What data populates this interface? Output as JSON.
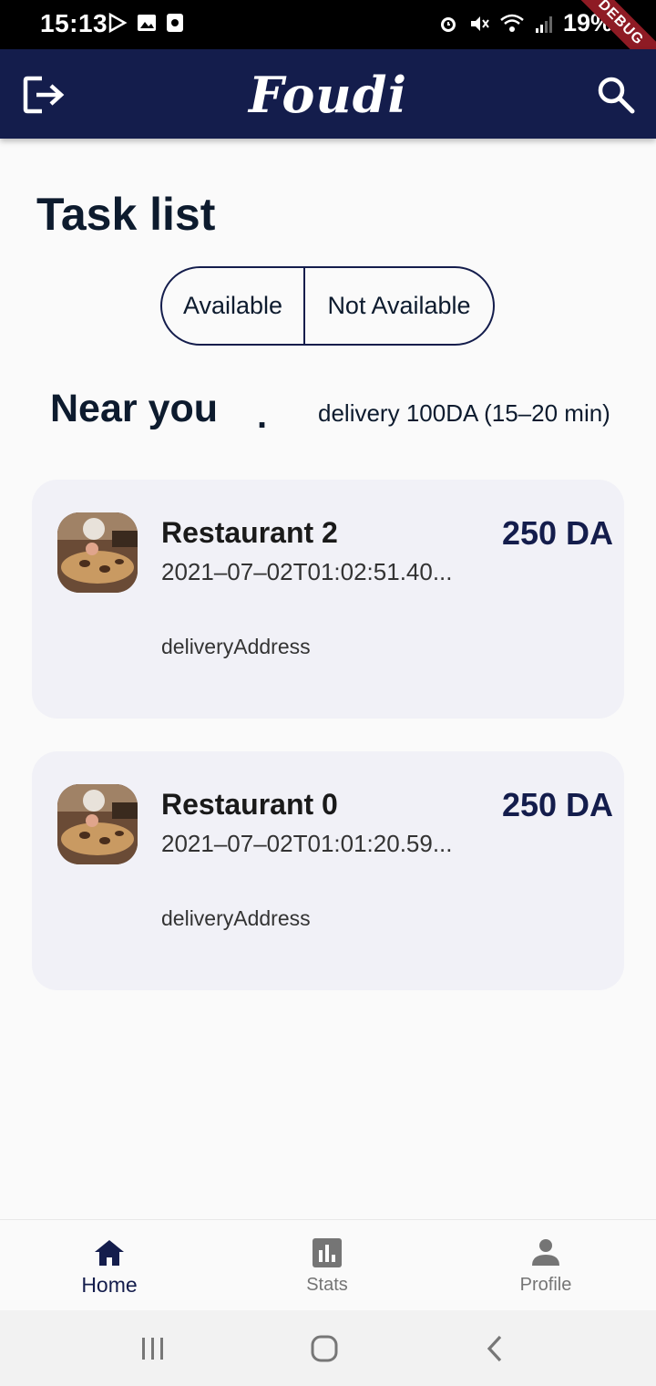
{
  "status_bar": {
    "time": "15:13",
    "battery": "19%",
    "debug_label": "DEBUG"
  },
  "app_bar": {
    "title": "Foudi"
  },
  "page": {
    "title": "Task list"
  },
  "availability": {
    "options": [
      "Available",
      "Not Available"
    ]
  },
  "near_you": {
    "heading": "Near you",
    "dot": ".",
    "delivery_info": "delivery 100DA (15–20 min)"
  },
  "tasks": [
    {
      "restaurant": "Restaurant 2",
      "date": "2021–07–02T01:02:51.40...",
      "price": "250 DA",
      "address": "deliveryAddress"
    },
    {
      "restaurant": "Restaurant 0",
      "date": "2021–07–02T01:01:20.59...",
      "price": "250 DA",
      "address": "deliveryAddress"
    }
  ],
  "bottom_nav": {
    "items": [
      {
        "label": "Home",
        "icon": "home-icon",
        "active": true
      },
      {
        "label": "Stats",
        "icon": "bar-chart-icon",
        "active": false
      },
      {
        "label": "Profile",
        "icon": "person-icon",
        "active": false
      }
    ]
  },
  "colors": {
    "primary": "#141d4c",
    "text": "#0d1b2e",
    "card": "#f1f1f7",
    "debug": "#8e1b24"
  }
}
